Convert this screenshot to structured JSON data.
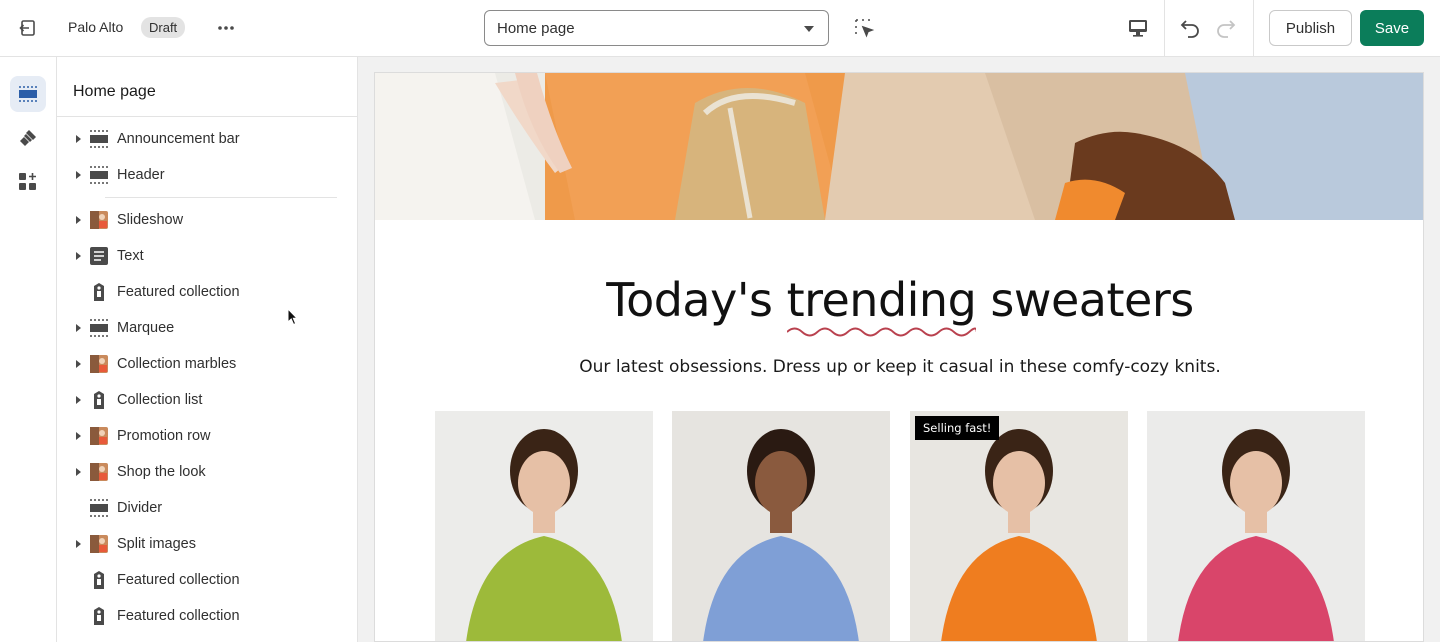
{
  "topbar": {
    "store_name": "Palo Alto",
    "status_badge": "Draft",
    "template_select": "Home page",
    "publish_label": "Publish",
    "save_label": "Save"
  },
  "rail": {
    "items": [
      "sections-icon",
      "theme-settings-icon",
      "apps-icon"
    ]
  },
  "sidebar": {
    "title": "Home page",
    "header_group": [
      {
        "label": "Announcement bar",
        "icon": "section-icon",
        "expandable": true
      },
      {
        "label": "Header",
        "icon": "section-icon",
        "expandable": true
      }
    ],
    "template_group": [
      {
        "label": "Slideshow",
        "icon": "image-thumb",
        "expandable": true
      },
      {
        "label": "Text",
        "icon": "text-icon",
        "expandable": true
      },
      {
        "label": "Featured collection",
        "icon": "tag-icon",
        "expandable": false
      },
      {
        "label": "Marquee",
        "icon": "section-icon",
        "expandable": true
      },
      {
        "label": "Collection marbles",
        "icon": "image-thumb",
        "expandable": true
      },
      {
        "label": "Collection list",
        "icon": "tag-icon",
        "expandable": true
      },
      {
        "label": "Promotion row",
        "icon": "image-thumb",
        "expandable": true
      },
      {
        "label": "Shop the look",
        "icon": "image-thumb",
        "expandable": true
      },
      {
        "label": "Divider",
        "icon": "section-icon",
        "expandable": false
      },
      {
        "label": "Split images",
        "icon": "image-thumb",
        "expandable": true
      },
      {
        "label": "Featured collection",
        "icon": "tag-icon",
        "expandable": false
      },
      {
        "label": "Featured collection",
        "icon": "tag-icon",
        "expandable": false
      }
    ]
  },
  "preview": {
    "headline_pre": "Today's ",
    "headline_em": "trending",
    "headline_post": " sweaters",
    "subheading": "Our latest obsessions. Dress up or keep it casual in these comfy-cozy knits.",
    "products": [
      {
        "color": "#9dba3a",
        "badge": ""
      },
      {
        "color": "#7f9fd6",
        "badge": ""
      },
      {
        "color": "#ef7d1f",
        "badge": "Selling fast!"
      },
      {
        "color": "#d9456a",
        "badge": ""
      }
    ]
  },
  "colors": {
    "accent_save": "#0b7d5a",
    "squiggle": "#b9414e"
  }
}
